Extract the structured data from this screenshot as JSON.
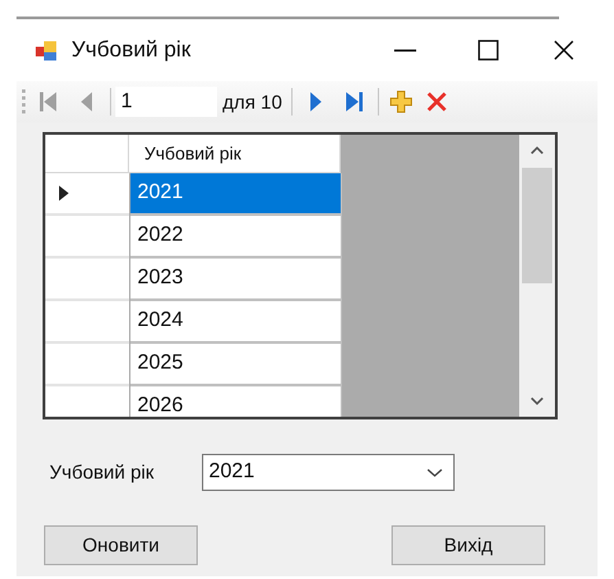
{
  "window": {
    "title": "Учбовий рік"
  },
  "tools": [
    {
      "kind": "first",
      "disabled": true
    },
    {
      "kind": "prev",
      "disabled": true
    },
    {
      "kind": "separator"
    },
    {
      "kind": "position",
      "value": "1"
    },
    {
      "kind": "count",
      "text": "для 10"
    },
    {
      "kind": "separator"
    },
    {
      "kind": "next",
      "disabled": false
    },
    {
      "kind": "last",
      "disabled": false
    },
    {
      "kind": "separator"
    },
    {
      "kind": "add"
    },
    {
      "kind": "delete"
    }
  ],
  "grid": {
    "column": "Учбовий рік",
    "rows": [
      {
        "value": "2021",
        "selected": true
      },
      {
        "value": "2022",
        "selected": false
      },
      {
        "value": "2023",
        "selected": false
      },
      {
        "value": "2024",
        "selected": false
      },
      {
        "value": "2025",
        "selected": false
      },
      {
        "value": "2026",
        "selected": false
      }
    ]
  },
  "filter": {
    "label": "Учбовий рік",
    "value": "2021"
  },
  "buttons": [
    "Оновити",
    "Вихід"
  ]
}
